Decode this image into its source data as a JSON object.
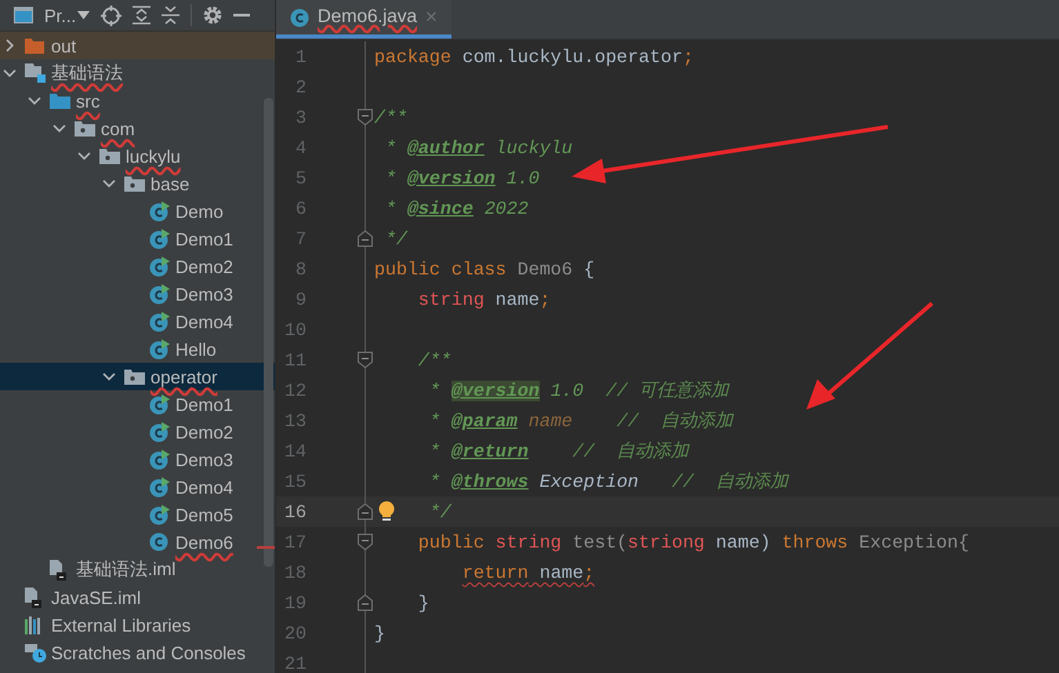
{
  "project_panel": {
    "title": "Pr...",
    "tree": [
      {
        "label": "out",
        "kind": "excluded-folder",
        "expanded": false,
        "selected": false,
        "misspelled": false
      },
      {
        "label": "基础语法",
        "kind": "module",
        "expanded": true,
        "selected": false,
        "misspelled": true,
        "children": [
          {
            "label": "src",
            "kind": "source-folder",
            "expanded": true,
            "selected": false,
            "misspelled": true,
            "children": [
              {
                "label": "com",
                "kind": "package",
                "expanded": true,
                "selected": false,
                "misspelled": true,
                "children": [
                  {
                    "label": "luckylu",
                    "kind": "package",
                    "expanded": true,
                    "selected": false,
                    "misspelled": true,
                    "children": [
                      {
                        "label": "base",
                        "kind": "package",
                        "expanded": true,
                        "selected": false,
                        "misspelled": false,
                        "children": [
                          {
                            "label": "Demo",
                            "kind": "runnable-class",
                            "selected": false,
                            "misspelled": false
                          },
                          {
                            "label": "Demo1",
                            "kind": "runnable-class",
                            "selected": false,
                            "misspelled": false
                          },
                          {
                            "label": "Demo2",
                            "kind": "runnable-class",
                            "selected": false,
                            "misspelled": false
                          },
                          {
                            "label": "Demo3",
                            "kind": "runnable-class",
                            "selected": false,
                            "misspelled": false
                          },
                          {
                            "label": "Demo4",
                            "kind": "runnable-class",
                            "selected": false,
                            "misspelled": false
                          },
                          {
                            "label": "Hello",
                            "kind": "runnable-class",
                            "selected": false,
                            "misspelled": false
                          }
                        ]
                      },
                      {
                        "label": "operator",
                        "kind": "package",
                        "expanded": true,
                        "selected": true,
                        "misspelled": true,
                        "children": [
                          {
                            "label": "Demo1",
                            "kind": "runnable-class",
                            "selected": false,
                            "misspelled": false
                          },
                          {
                            "label": "Demo2",
                            "kind": "runnable-class",
                            "selected": false,
                            "misspelled": false
                          },
                          {
                            "label": "Demo3",
                            "kind": "runnable-class",
                            "selected": false,
                            "misspelled": false
                          },
                          {
                            "label": "Demo4",
                            "kind": "runnable-class",
                            "selected": false,
                            "misspelled": false
                          },
                          {
                            "label": "Demo5",
                            "kind": "runnable-class",
                            "selected": false,
                            "misspelled": false
                          },
                          {
                            "label": "Demo6",
                            "kind": "class",
                            "selected": false,
                            "misspelled": true
                          }
                        ]
                      }
                    ]
                  }
                ]
              }
            ]
          },
          {
            "label": "基础语法.iml",
            "kind": "iml",
            "selected": false,
            "misspelled": false
          }
        ]
      },
      {
        "label": "JavaSE.iml",
        "kind": "iml",
        "selected": false,
        "misspelled": false
      },
      {
        "label": "External Libraries",
        "kind": "libraries",
        "selected": false,
        "misspelled": false
      },
      {
        "label": "Scratches and Consoles",
        "kind": "scratches",
        "selected": false,
        "misspelled": false
      }
    ]
  },
  "editor": {
    "tabs": [
      {
        "label": "Demo6.java",
        "close": "×",
        "selected": true,
        "misspelled": true
      }
    ],
    "lines": [
      {
        "number": "1",
        "kind": "plain",
        "current": false,
        "error": false,
        "tokens": [
          {
            "text": "package",
            "kind": "keyword"
          },
          {
            "text": " com.luckylu.operator",
            "kind": "plain"
          },
          {
            "text": ";",
            "kind": "keyword"
          }
        ]
      },
      {
        "number": "2",
        "kind": "plain",
        "current": false
      },
      {
        "number": "3",
        "kind": "fold-start",
        "current": false,
        "error": false,
        "tokens": [
          {
            "text": "/**",
            "kind": "doc"
          }
        ]
      },
      {
        "number": "4",
        "kind": "plain",
        "current": false,
        "error": false,
        "tokens": [
          {
            "text": " * ",
            "kind": "doc"
          },
          {
            "text": "@author",
            "kind": "tag"
          },
          {
            "text": " luckylu",
            "kind": "doc"
          }
        ]
      },
      {
        "number": "5",
        "kind": "plain",
        "current": false,
        "error": false,
        "tokens": [
          {
            "text": " * ",
            "kind": "doc"
          },
          {
            "text": "@version",
            "kind": "tag"
          },
          {
            "text": " 1.0",
            "kind": "doc"
          }
        ]
      },
      {
        "number": "6",
        "kind": "plain",
        "current": false,
        "error": false,
        "tokens": [
          {
            "text": " * ",
            "kind": "doc"
          },
          {
            "text": "@since",
            "kind": "tag"
          },
          {
            "text": " 2022",
            "kind": "doc"
          }
        ]
      },
      {
        "number": "7",
        "kind": "fold-end",
        "current": false,
        "error": false,
        "tokens": [
          {
            "text": " */",
            "kind": "doc"
          }
        ]
      },
      {
        "number": "8",
        "kind": "plain",
        "current": false,
        "error": false,
        "tokens": [
          {
            "text": "public class ",
            "kind": "keyword"
          },
          {
            "text": "Demo6 ",
            "kind": "unused"
          },
          {
            "text": "{",
            "kind": "plain"
          }
        ]
      },
      {
        "number": "9",
        "kind": "plain",
        "current": false,
        "error": false,
        "tokens": [
          {
            "text": "    string",
            "kind": "unresolved"
          },
          {
            "text": " name",
            "kind": "plain"
          },
          {
            "text": ";",
            "kind": "keyword"
          }
        ]
      },
      {
        "number": "10",
        "kind": "plain",
        "current": false
      },
      {
        "number": "11",
        "kind": "fold-start",
        "current": false,
        "error": false,
        "tokens": [
          {
            "text": "    /**",
            "kind": "doc"
          }
        ]
      },
      {
        "number": "12",
        "kind": "plain",
        "current": false,
        "error": false,
        "tokens": [
          {
            "text": "     * ",
            "kind": "doc"
          },
          {
            "text": "@version",
            "kind": "tag-highlight"
          },
          {
            "text": " 1.0  ",
            "kind": "doc"
          },
          {
            "text": "// 可任意添加",
            "kind": "doc-note"
          }
        ]
      },
      {
        "number": "13",
        "kind": "plain",
        "current": false,
        "error": false,
        "tokens": [
          {
            "text": "     * ",
            "kind": "doc"
          },
          {
            "text": "@param",
            "kind": "tag"
          },
          {
            "text": " name",
            "kind": "param"
          },
          {
            "text": "    //  自动添加",
            "kind": "doc-note"
          }
        ]
      },
      {
        "number": "14",
        "kind": "plain",
        "current": false,
        "error": false,
        "tokens": [
          {
            "text": "     * ",
            "kind": "doc"
          },
          {
            "text": "@return",
            "kind": "tag"
          },
          {
            "text": "    //  自动添加",
            "kind": "doc-note"
          }
        ]
      },
      {
        "number": "15",
        "kind": "plain",
        "current": false,
        "error": false,
        "tokens": [
          {
            "text": "     * ",
            "kind": "doc"
          },
          {
            "text": "@throws",
            "kind": "tag"
          },
          {
            "text": " Exception",
            "kind": "doc-type"
          },
          {
            "text": "   //  自动添加",
            "kind": "doc-note"
          }
        ]
      },
      {
        "number": "16",
        "kind": "fold-end",
        "current": true,
        "error": false,
        "tokens": [
          {
            "text": "     */",
            "kind": "doc"
          }
        ]
      },
      {
        "number": "17",
        "kind": "fold-start",
        "current": false,
        "error": false,
        "tokens": [
          {
            "text": "    public ",
            "kind": "keyword"
          },
          {
            "text": "string ",
            "kind": "unresolved"
          },
          {
            "text": "test(",
            "kind": "unused"
          },
          {
            "text": "striong",
            "kind": "unresolved"
          },
          {
            "text": " name) ",
            "kind": "plain"
          },
          {
            "text": "throws ",
            "kind": "keyword"
          },
          {
            "text": "Exception{",
            "kind": "unused"
          }
        ]
      },
      {
        "number": "18",
        "kind": "plain",
        "current": false,
        "error": true,
        "tokens": [
          {
            "text": "        return",
            "kind": "keyword"
          },
          {
            "text": " name",
            "kind": "plain"
          },
          {
            "text": ";",
            "kind": "keyword"
          }
        ]
      },
      {
        "number": "19",
        "kind": "fold-end",
        "current": false,
        "error": false,
        "tokens": [
          {
            "text": "    }",
            "kind": "plain"
          }
        ]
      },
      {
        "number": "20",
        "kind": "plain",
        "current": false,
        "error": false,
        "tokens": [
          {
            "text": "}",
            "kind": "plain"
          }
        ]
      },
      {
        "number": "21",
        "kind": "plain",
        "current": false
      }
    ]
  }
}
